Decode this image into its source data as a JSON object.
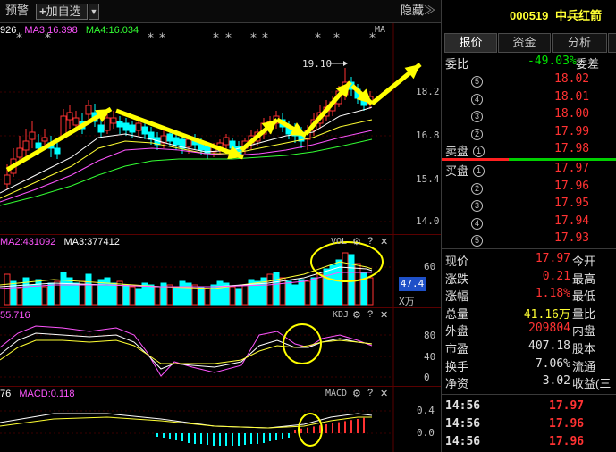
{
  "toolbar": {
    "alert_label": "预警",
    "add_label": "加自选",
    "add_plus": "+",
    "dropdown_glyph": "▼",
    "hide_label": "隐藏",
    "hide_glyph": "≫"
  },
  "price_panel": {
    "legend": [
      {
        "text": "926",
        "color": "#ffffff"
      },
      {
        "text": "MA3:16.398",
        "color": "#ff55ff"
      },
      {
        "text": "MA4:16.034",
        "color": "#33ff33"
      }
    ],
    "title": "MA",
    "y_ticks": [
      "18.2",
      "16.8",
      "15.4",
      "14.0"
    ],
    "high_label": "19.10",
    "star": "*"
  },
  "vol_panel": {
    "legend": [
      {
        "text": "MA2:431092",
        "color": "#ff55ff"
      },
      {
        "text": "MA3:377412",
        "color": "#ffffff"
      }
    ],
    "title": "VOL",
    "y_tick": "60",
    "current_value": "47.4",
    "unit": "X万"
  },
  "kdj_panel": {
    "legend": [
      {
        "text": "55.716",
        "color": "#ff55ff"
      }
    ],
    "title": "KDJ",
    "y_ticks": [
      "80",
      "40",
      "0"
    ]
  },
  "macd_panel": {
    "legend": [
      {
        "text": "76",
        "color": "#ffffff"
      },
      {
        "text": "MACD:0.118",
        "color": "#ff55ff"
      }
    ],
    "title": "MACD",
    "y_ticks": [
      "0.4",
      "0.0"
    ]
  },
  "panel_tools": {
    "gear_glyph": "⚙",
    "help_glyph": "?",
    "close_glyph": "✕"
  },
  "side": {
    "stock_code": "000519",
    "stock_name": "中兵红箭",
    "tabs": [
      "报价",
      "资金",
      "分析"
    ],
    "weibi_label": "委比",
    "weibi_value": "-49.03%",
    "weicha_label": "委差",
    "asks": [
      {
        "num": "5",
        "price": "18.02"
      },
      {
        "num": "4",
        "price": "18.01"
      },
      {
        "num": "3",
        "price": "18.00"
      },
      {
        "num": "2",
        "price": "17.99"
      },
      {
        "num": "1",
        "price": "17.98",
        "label": "卖盘"
      }
    ],
    "bids": [
      {
        "num": "1",
        "price": "17.97",
        "label": "买盘"
      },
      {
        "num": "2",
        "price": "17.96"
      },
      {
        "num": "3",
        "price": "17.95"
      },
      {
        "num": "4",
        "price": "17.94"
      },
      {
        "num": "5",
        "price": "17.93"
      }
    ],
    "stats": [
      {
        "l1": "现价",
        "v1": "17.97",
        "c1": "red",
        "l2": "今开"
      },
      {
        "l1": "涨跌",
        "v1": "0.21",
        "c1": "red",
        "l2": "最高"
      },
      {
        "l1": "涨幅",
        "v1": "1.18%",
        "c1": "red",
        "l2": "最低"
      },
      {
        "l1": "总量",
        "v1": "41.16万",
        "c1": "yellow",
        "l2": "量比"
      },
      {
        "l1": "外盘",
        "v1": "209804",
        "c1": "red",
        "l2": "内盘"
      },
      {
        "l1": "市盈",
        "v1": "407.18",
        "c1": "white",
        "l2": "股本"
      },
      {
        "l1": "换手",
        "v1": "7.06%",
        "c1": "white",
        "l2": "流通"
      },
      {
        "l1": "净资",
        "v1": "3.02",
        "c1": "white",
        "l2": "收益(三"
      }
    ],
    "ticks": [
      {
        "time": "14:56",
        "price": "17.97"
      },
      {
        "time": "14:56",
        "price": "17.96"
      },
      {
        "time": "14:56",
        "price": "17.96"
      }
    ]
  },
  "colors": {
    "up": "#ff3232",
    "down": "#00ffff",
    "arrow": "#ffff00",
    "ma_white": "#ffffff",
    "ma_yellow": "#ffff33",
    "ma_pink": "#ff55ff",
    "ma_green": "#33ff33"
  }
}
